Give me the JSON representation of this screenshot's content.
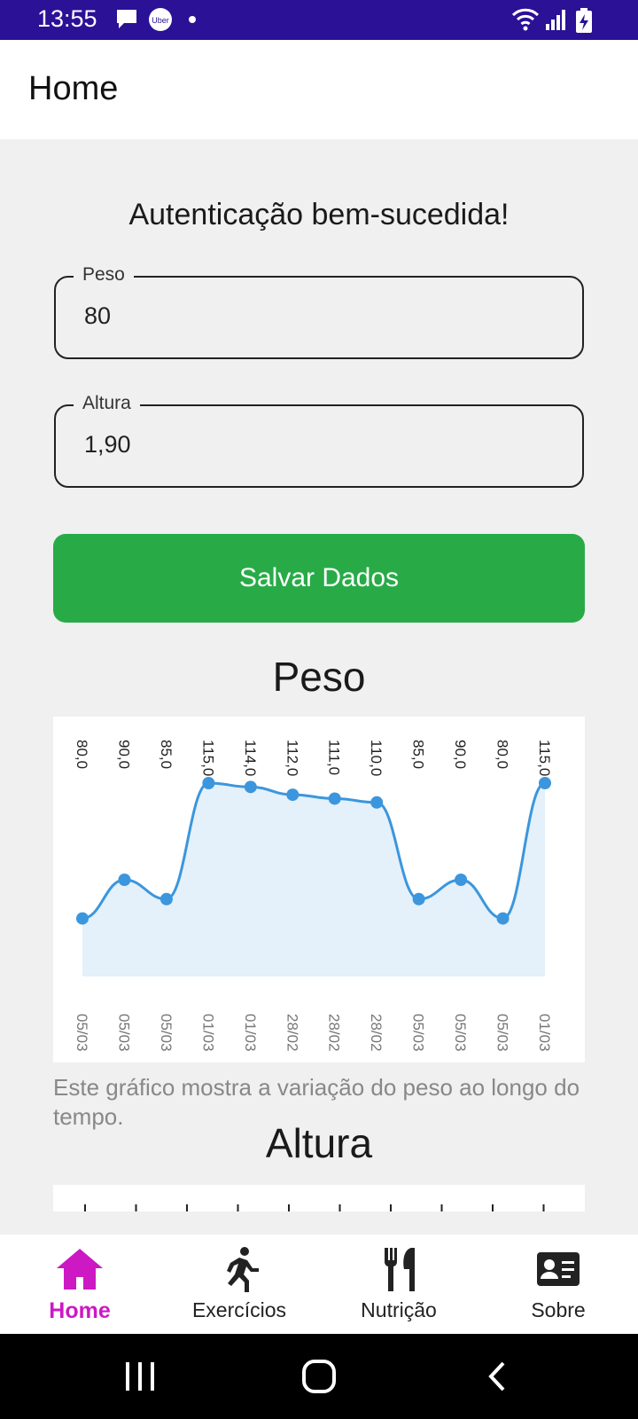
{
  "status_bar": {
    "time": "13:55",
    "notif_icons": [
      "message-icon",
      "uber-icon",
      "dot-icon"
    ],
    "system_icons": [
      "wifi-icon",
      "signal-icon",
      "battery-charging-icon"
    ]
  },
  "app_bar": {
    "title": "Home"
  },
  "auth_message": "Autenticação bem-sucedida!",
  "form": {
    "weight": {
      "label": "Peso",
      "value": "80"
    },
    "height": {
      "label": "Altura",
      "value": "1,90"
    },
    "save_label": "Salvar Dados"
  },
  "weight_chart": {
    "title": "Peso",
    "caption": "Este gráfico mostra a variação do peso ao longo do tempo."
  },
  "height_chart": {
    "title": "Altura"
  },
  "chart_data": [
    {
      "type": "area",
      "title": "Peso",
      "x": [
        "05/03",
        "05/03",
        "05/03",
        "01/03",
        "01/03",
        "28/02",
        "28/02",
        "28/02",
        "05/03",
        "05/03",
        "05/03",
        "01/03"
      ],
      "values": [
        80,
        90,
        85,
        115,
        114,
        112,
        111,
        110,
        85,
        90,
        80,
        115
      ],
      "value_labels": [
        "80,0",
        "90,0",
        "85,0",
        "115,0",
        "114,0",
        "112,0",
        "111,0",
        "110,0",
        "85,0",
        "90,0",
        "80,0",
        "115,0"
      ],
      "ylim": [
        0,
        115
      ],
      "colors": {
        "line": "#3b96dd",
        "fill": "#e4f0fa"
      }
    },
    {
      "type": "area",
      "title": "Altura",
      "partially_visible": true
    }
  ],
  "bottom_nav": [
    {
      "label": "Home",
      "icon": "home-icon",
      "active": true
    },
    {
      "label": "Exercícios",
      "icon": "running-person-icon",
      "active": false
    },
    {
      "label": "Nutrição",
      "icon": "fork-knife-icon",
      "active": false
    },
    {
      "label": "Sobre",
      "icon": "id-card-icon",
      "active": false
    }
  ],
  "system_nav": [
    "recent-apps-icon",
    "home-circle-icon",
    "back-icon"
  ],
  "colors": {
    "status_bar": "#2a1196",
    "accent_active": "#cc19c4",
    "save_button": "#28ab47",
    "chart_line": "#3b96dd"
  }
}
